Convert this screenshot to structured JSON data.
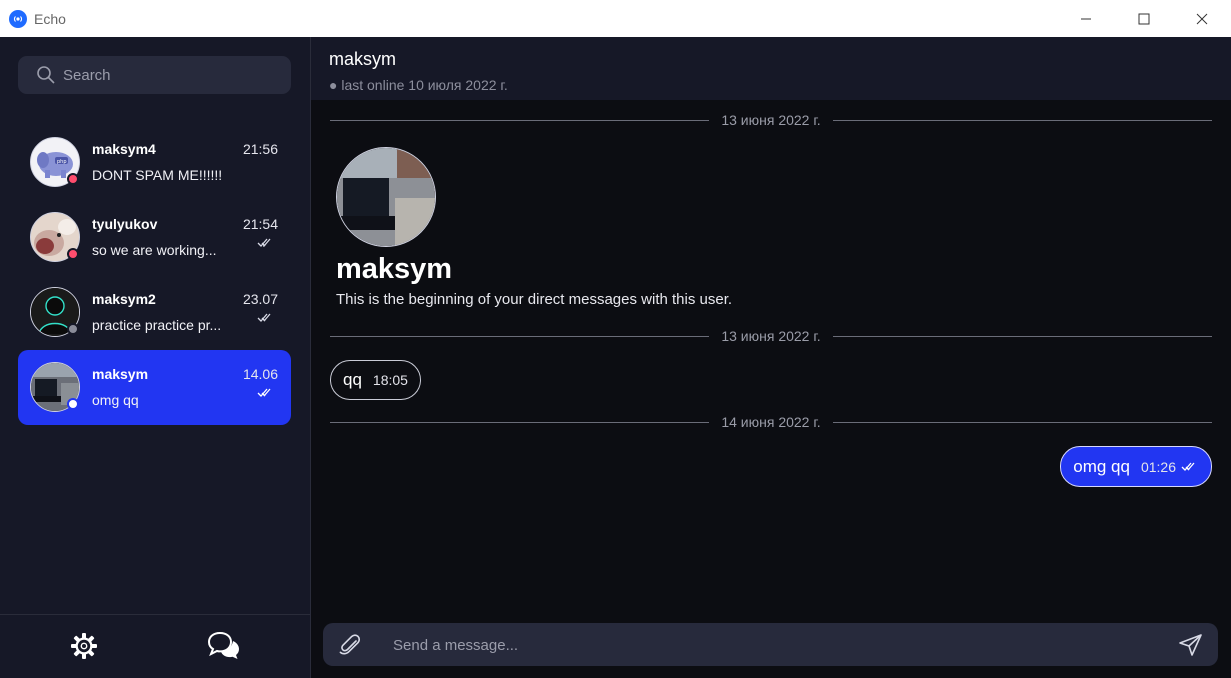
{
  "window": {
    "title": "Echo"
  },
  "sidebar": {
    "search_placeholder": "Search",
    "chats": [
      {
        "name": "maksym4",
        "time": "21:56",
        "preview": "DONT SPAM ME!!!!!!",
        "status_color": "#ff4d6d",
        "read": false,
        "active": false
      },
      {
        "name": "tyulyukov",
        "time": "21:54",
        "preview": "so we are working...",
        "status_color": "#ff4d6d",
        "read": true,
        "active": false
      },
      {
        "name": "maksym2",
        "time": "23.07",
        "preview": "practice practice pr...",
        "status_color": "#8a8c99",
        "read": true,
        "active": false
      },
      {
        "name": "maksym",
        "time": "14.06",
        "preview": "omg qq",
        "status_color": "#ffffff",
        "read": true,
        "active": true
      }
    ],
    "footer": {
      "settings_icon": "gear-icon",
      "chats_icon": "chat-bubbles-icon"
    }
  },
  "conversation": {
    "header": {
      "name": "maksym",
      "status": "● last online 10 июля 2022 г."
    },
    "dividers": [
      "13 июня 2022 г.",
      "13 июня 2022 г.",
      "14 июня 2022 г."
    ],
    "profile": {
      "name": "maksym",
      "description": "This is the beginning of your direct messages with this user."
    },
    "messages": [
      {
        "direction": "incoming",
        "text": "qq",
        "time": "18:05"
      },
      {
        "direction": "outgoing",
        "text": "omg qq",
        "time": "01:26",
        "read": true
      }
    ],
    "composer": {
      "placeholder": "Send a message..."
    }
  },
  "colors": {
    "accent": "#2236f2",
    "sidebar_bg": "#161827",
    "chat_bg": "#0c0d12",
    "input_bg": "#272a3c"
  }
}
